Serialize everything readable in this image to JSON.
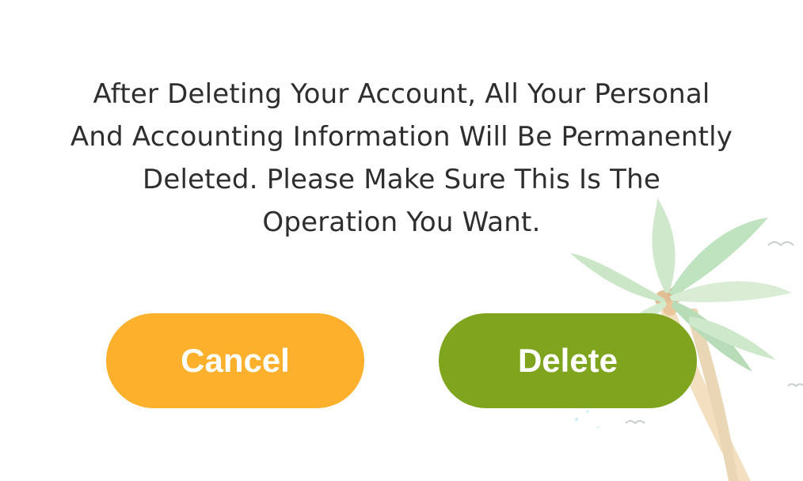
{
  "dialog": {
    "message_lines": [
      "After Deleting Your Account, All Your Personal",
      "And Accounting Information Will Be Permanently",
      "Deleted. Please Make Sure This Is The",
      "Operation You Want."
    ]
  },
  "buttons": {
    "cancel_label": "Cancel",
    "delete_label": "Delete"
  },
  "colors": {
    "cancel": "#fcb02b",
    "delete": "#7fa41e",
    "text": "#2e2e2e"
  },
  "decoration": {
    "icon": "palm-tree-illustration"
  }
}
